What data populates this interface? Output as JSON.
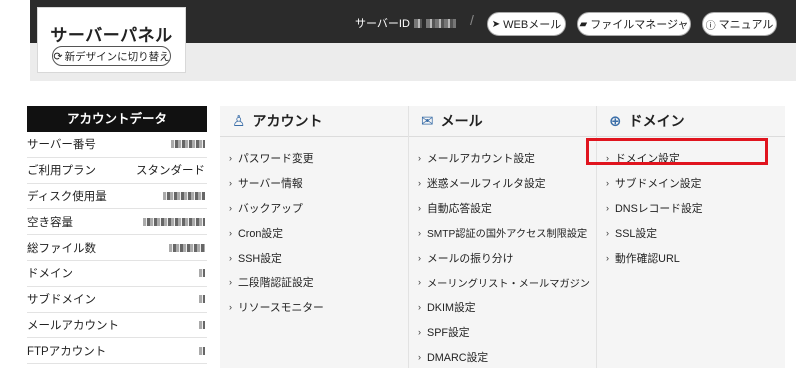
{
  "header": {
    "panel_title": "サーバーパネル",
    "switch_label": "新デザインに切り替え",
    "server_id_label": "サーバーID",
    "separator": "/",
    "buttons": [
      {
        "label": "WEBメール",
        "icon": "paper-plane-icon"
      },
      {
        "label": "ファイルマネージャ",
        "icon": "folder-icon"
      },
      {
        "label": "マニュアル",
        "icon": "question-circle-icon"
      }
    ]
  },
  "account": {
    "title": "アカウントデータ",
    "rows": [
      {
        "label": "サーバー番号",
        "value": ""
      },
      {
        "label": "ご利用プラン",
        "value": "スタンダード"
      },
      {
        "label": "ディスク使用量",
        "value": ""
      },
      {
        "label": "空き容量",
        "value": ""
      },
      {
        "label": "総ファイル数",
        "value": ""
      },
      {
        "label": "ドメイン",
        "value": ""
      },
      {
        "label": "サブドメイン",
        "value": ""
      },
      {
        "label": "メールアカウント",
        "value": ""
      },
      {
        "label": "FTPアカウント",
        "value": ""
      }
    ]
  },
  "menus": [
    {
      "title": "アカウント",
      "icon": "user-icon",
      "items": [
        "パスワード変更",
        "サーバー情報",
        "バックアップ",
        "Cron設定",
        "SSH設定",
        "二段階認証設定",
        "リソースモニター"
      ]
    },
    {
      "title": "メール",
      "icon": "envelope-icon",
      "items": [
        "メールアカウント設定",
        "迷惑メールフィルタ設定",
        "自動応答設定",
        "SMTP認証の国外アクセス制限設定",
        "メールの振り分け",
        "メーリングリスト・メールマガジン",
        "DKIM設定",
        "SPF設定",
        "DMARC設定"
      ]
    },
    {
      "title": "ドメイン",
      "icon": "globe-icon",
      "items": [
        "ドメイン設定",
        "サブドメイン設定",
        "DNSレコード設定",
        "SSL設定",
        "動作確認URL"
      ]
    }
  ],
  "colors": {
    "header_bg": "#2b2b2b",
    "highlight": "#e0141e",
    "icon_accent": "#3b6ea8"
  }
}
